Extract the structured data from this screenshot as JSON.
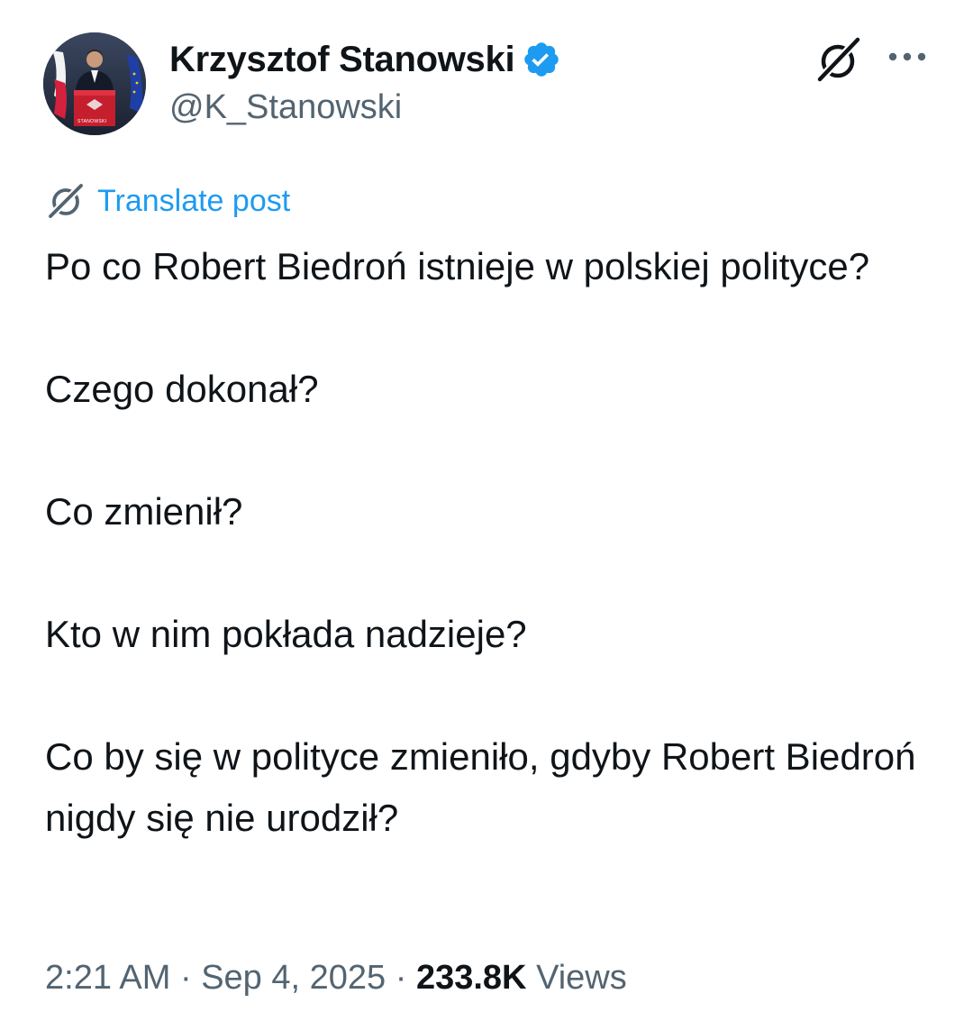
{
  "author": {
    "display_name": "Krzysztof Stanowski",
    "handle": "@K_Stanowski",
    "verified_color": "#1d9bf0",
    "avatar_podium_text": "STANOWSKI"
  },
  "icons": {
    "grok": "grok-icon",
    "more": "more-icon",
    "verified": "verified-badge-icon",
    "translate": "translate-icon"
  },
  "translate": {
    "label": "Translate post"
  },
  "tweet": {
    "paragraphs": [
      "Po co Robert Biedroń istnieje w polskiej polityce?",
      "Czego dokonał?",
      "Co zmienił?",
      "Kto w nim pokłada nadzieje?",
      "Co by się w polityce zmieniło, gdyby Robert Biedroń nigdy się nie urodził?"
    ]
  },
  "meta": {
    "time": "2:21 AM",
    "separator": " · ",
    "date": "Sep 4, 2025",
    "views_count": "233.8K",
    "views_label": "Views"
  },
  "colors": {
    "text_primary": "#0f1419",
    "text_secondary": "#536471",
    "accent": "#1d9bf0"
  }
}
